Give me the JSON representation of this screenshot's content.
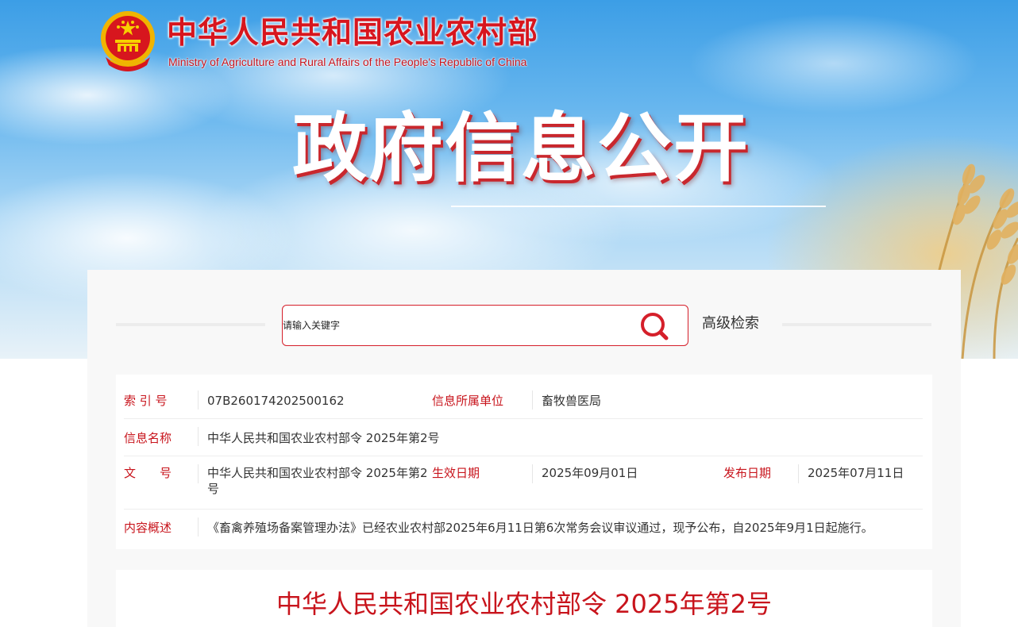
{
  "header": {
    "ministry_cn": "中华人民共和国农业农村部",
    "ministry_en": "Ministry of Agriculture and Rural Affairs of the People's Republic of China",
    "banner_title": "政府信息公开",
    "emblem_icon": "national-emblem-icon"
  },
  "search": {
    "placeholder": "请输入关键字",
    "button_icon": "search-icon",
    "advanced_label": "高级检索"
  },
  "info": {
    "index_label": "索 引 号",
    "index_value": "07B260174202500162",
    "unit_label": "信息所属单位",
    "unit_value": "畜牧兽医局",
    "name_label": "信息名称",
    "name_value": "中华人民共和国农业农村部令 2025年第2号",
    "docno_label": "文　　号",
    "docno_value": "中华人民共和国农业农村部令 2025年第2号",
    "effective_label": "生效日期",
    "effective_value": "2025年09月01日",
    "publish_label": "发布日期",
    "publish_value": "2025年07月11日",
    "summary_label": "内容概述",
    "summary_value": "《畜禽养殖场备案管理办法》已经农业农村部2025年6月11日第6次常务会议审议通过，现予公布，自2025年9月1日起施行。"
  },
  "document": {
    "title": "中华人民共和国农业农村部令 2025年第2号"
  },
  "colors": {
    "accent_red": "#c8141c",
    "search_border": "#d51f2a",
    "panel_bg": "#f8f8f8"
  }
}
